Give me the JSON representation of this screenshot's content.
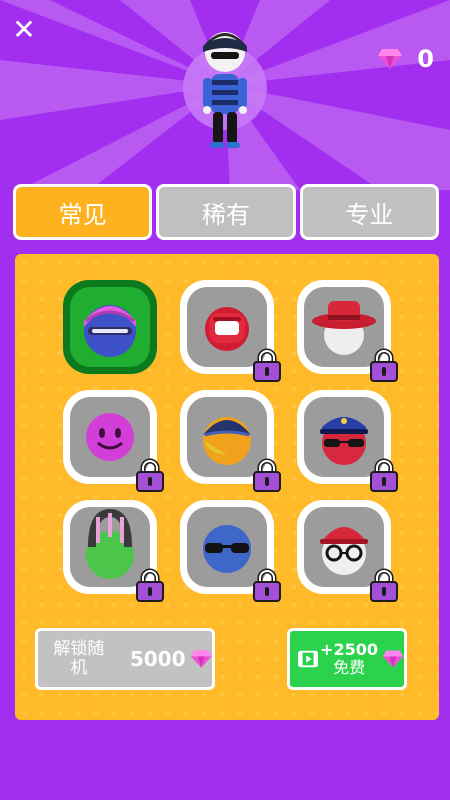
{
  "header": {
    "close_symbol": "✕",
    "gem_count": "0",
    "gem_icon": "pink-diamond-icon"
  },
  "tabs": [
    {
      "label": "常见",
      "active": true
    },
    {
      "label": "稀有",
      "active": false
    },
    {
      "label": "专业",
      "active": false
    }
  ],
  "items": [
    {
      "name": "purple-beanie-mask",
      "locked": false,
      "selected": true
    },
    {
      "name": "red-helmet",
      "locked": true,
      "selected": false
    },
    {
      "name": "red-fedora",
      "locked": true,
      "selected": false
    },
    {
      "name": "pink-smiley",
      "locked": true,
      "selected": false
    },
    {
      "name": "yellow-cap",
      "locked": true,
      "selected": false
    },
    {
      "name": "police-cap-sunglasses",
      "locked": true,
      "selected": false
    },
    {
      "name": "green-headphones",
      "locked": true,
      "selected": false
    },
    {
      "name": "blue-sunglasses",
      "locked": true,
      "selected": false
    },
    {
      "name": "red-cap-glasses",
      "locked": true,
      "selected": false
    }
  ],
  "unlock_random": {
    "label": "解锁随机",
    "price": "5000"
  },
  "free_gems": {
    "amount": "+2500",
    "label": "免费"
  },
  "colors": {
    "background": "#a22ff0",
    "tab_active": "#ffb21f",
    "tab_inactive": "#c0c0c0",
    "panel": "#ffba2a",
    "lock": "#a34fd6",
    "gem": "#f04fd8",
    "free_button": "#2bd24c"
  }
}
